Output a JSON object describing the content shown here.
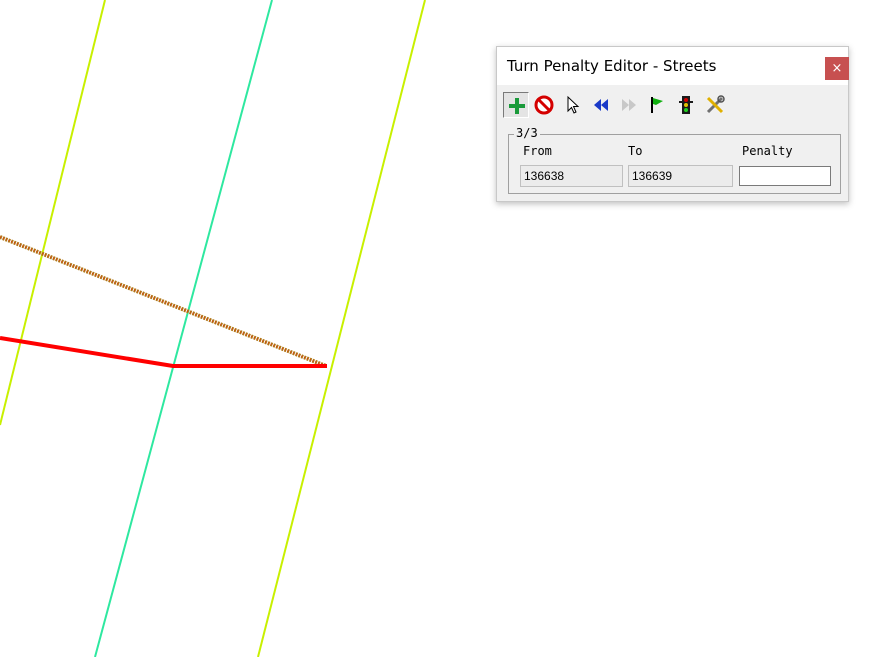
{
  "dialog": {
    "title": "Turn Penalty Editor - Streets",
    "close_label": "×",
    "record_position": "3/3",
    "columns": {
      "from": "From",
      "to": "To",
      "penalty": "Penalty"
    },
    "values": {
      "from": "136638",
      "to": "136639",
      "penalty": ""
    }
  },
  "toolbar": {
    "buttons": [
      {
        "name": "add-penalty",
        "icon": "plus-icon",
        "pressed": true
      },
      {
        "name": "delete-penalty",
        "icon": "prohibited-icon"
      },
      {
        "name": "select",
        "icon": "pointer-arrow-icon"
      },
      {
        "name": "previous",
        "icon": "rewind-icon"
      },
      {
        "name": "next",
        "icon": "fast-forward-icon"
      },
      {
        "name": "flag",
        "icon": "flag-icon"
      },
      {
        "name": "traffic-light",
        "icon": "traffic-light-icon"
      },
      {
        "name": "tools",
        "icon": "tools-icon"
      }
    ]
  },
  "colors": {
    "street_yellow_green": "#c8f000",
    "street_green": "#2ee8a0",
    "route_red": "#ff0000",
    "route_dotted_brown": "#b07818",
    "close_red": "#c75050"
  }
}
